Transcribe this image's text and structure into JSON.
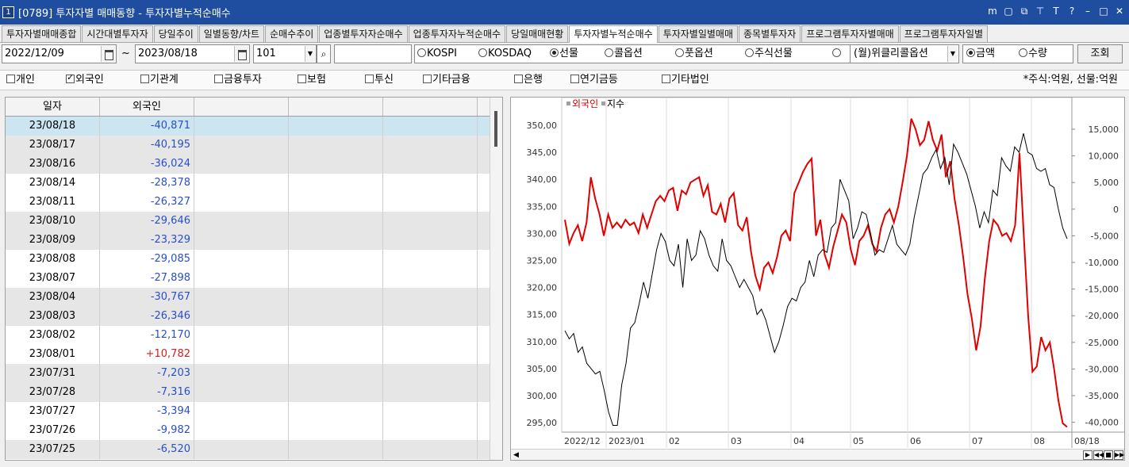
{
  "window": {
    "badge": "1",
    "title": "[0789] 투자자별 매매동향 - 투자자별누적순매수",
    "icons": [
      "menu-icon",
      "save-icon",
      "link-icon",
      "pin-icon",
      "font-icon",
      "help-icon",
      "minimize-icon",
      "maximize-icon",
      "close-icon"
    ]
  },
  "tabs": [
    {
      "label": "투자자별매매종합",
      "active": false
    },
    {
      "label": "시간대별투자자",
      "active": false
    },
    {
      "label": "당일추이",
      "active": false
    },
    {
      "label": "일별동향/차트",
      "active": false
    },
    {
      "label": "순매수추이",
      "active": false
    },
    {
      "label": "업종별투자자순매수",
      "active": false
    },
    {
      "label": "업종투자자누적순매수",
      "active": false
    },
    {
      "label": "당일매매현황",
      "active": false
    },
    {
      "label": "투자자별누적순매수",
      "active": true
    },
    {
      "label": "투자자별일별매매",
      "active": false
    },
    {
      "label": "종목별투자자",
      "active": false
    },
    {
      "label": "프로그램투자자별매매",
      "active": false
    },
    {
      "label": "프로그램투자자일별",
      "active": false
    }
  ],
  "controls": {
    "start_date": "2022/12/09",
    "tilde": "~",
    "end_date": "2023/08/18",
    "code": "101",
    "code_input": "",
    "market_radios": [
      {
        "label": "KOSPI",
        "checked": false
      },
      {
        "label": "KOSDAQ",
        "checked": false
      },
      {
        "label": "선물",
        "checked": true
      },
      {
        "label": "콜옵션",
        "checked": false
      },
      {
        "label": "풋옵션",
        "checked": false
      },
      {
        "label": "주식선물",
        "checked": false
      },
      {
        "label": "",
        "checked": false
      }
    ],
    "weekly_select": "(월)위클리콜옵션",
    "mode_radios": [
      {
        "label": "금액",
        "checked": true
      },
      {
        "label": "수량",
        "checked": false
      }
    ],
    "search_button": "조회"
  },
  "investors": [
    {
      "label": "개인",
      "checked": false
    },
    {
      "label": "외국인",
      "checked": true
    },
    {
      "label": "기관계",
      "checked": false
    },
    {
      "label": "금융투자",
      "checked": false
    },
    {
      "label": "보험",
      "checked": false
    },
    {
      "label": "투신",
      "checked": false
    },
    {
      "label": "기타금융",
      "checked": false
    },
    {
      "label": "은행",
      "checked": false
    },
    {
      "label": "연기금등",
      "checked": false
    },
    {
      "label": "기타법인",
      "checked": false
    }
  ],
  "unit_note": "*주식:억원, 선물:억원",
  "grid": {
    "headers": [
      "일자",
      "외국인",
      "",
      "",
      "",
      ""
    ],
    "rows": [
      {
        "date": "23/08/18",
        "value": "-40,871"
      },
      {
        "date": "23/08/17",
        "value": "-40,195"
      },
      {
        "date": "23/08/16",
        "value": "-36,024"
      },
      {
        "date": "23/08/14",
        "value": "-28,378"
      },
      {
        "date": "23/08/11",
        "value": "-26,327"
      },
      {
        "date": "23/08/10",
        "value": "-29,646"
      },
      {
        "date": "23/08/09",
        "value": "-23,329"
      },
      {
        "date": "23/08/08",
        "value": "-29,085"
      },
      {
        "date": "23/08/07",
        "value": "-27,898"
      },
      {
        "date": "23/08/04",
        "value": "-30,767"
      },
      {
        "date": "23/08/03",
        "value": "-26,346"
      },
      {
        "date": "23/08/02",
        "value": "-12,170"
      },
      {
        "date": "23/08/01",
        "value": "+10,782"
      },
      {
        "date": "23/07/31",
        "value": "-7,203"
      },
      {
        "date": "23/07/28",
        "value": "-7,316"
      },
      {
        "date": "23/07/27",
        "value": "-3,394"
      },
      {
        "date": "23/07/26",
        "value": "-9,982"
      },
      {
        "date": "23/07/25",
        "value": "-6,520"
      }
    ]
  },
  "chart_data": {
    "type": "line",
    "legend": [
      "외국인",
      "지수"
    ],
    "x_labels": [
      "2022/12",
      "2023/01",
      "02",
      "03",
      "04",
      "05",
      "06",
      "07",
      "08",
      "08/18"
    ],
    "left_axis": {
      "ticks": [
        "350,00",
        "345,00",
        "340,00",
        "335,00",
        "330,00",
        "325,00",
        "320,00",
        "315,00",
        "310,00",
        "305,00",
        "300,00",
        "295,00"
      ],
      "ylim": [
        295,
        350
      ]
    },
    "right_axis": {
      "ticks": [
        "15,000",
        "10,000",
        "5,000",
        "0",
        "-5,000",
        "-10,000",
        "-15,000",
        "-20,000",
        "-25,000",
        "-30,000",
        "-35,000",
        "-40,000"
      ],
      "ylim": [
        -40000,
        15000
      ]
    },
    "series": [
      {
        "name": "외국인",
        "axis": "right",
        "color": "#e00000",
        "values": [
          -2000,
          -6500,
          -4500,
          -3000,
          -6000,
          -2500,
          6000,
          2000,
          -1000,
          -5000,
          -1000,
          -3500,
          -2500,
          -3500,
          -2000,
          -3000,
          -2500,
          -4500,
          -1000,
          -3500,
          -1000,
          1500,
          2500,
          1500,
          3500,
          4000,
          -300,
          3500,
          2800,
          5000,
          5500,
          6000,
          2500,
          4500,
          -500,
          -1000,
          1000,
          -2500,
          2000,
          3000,
          -3000,
          -4000,
          -1500,
          -8000,
          -12500,
          -15000,
          -11000,
          -10000,
          -12000,
          -9000,
          -5000,
          -4000,
          -6000,
          3000,
          5000,
          7000,
          8500,
          9500,
          -5000,
          -2000,
          -8500,
          -11000,
          -7000,
          -4000,
          -1000,
          -2500,
          -7500,
          -10500,
          -6000,
          -5000,
          -3000,
          -6500,
          -8000,
          -3500,
          -1000,
          0,
          -2500,
          500,
          5000,
          10000,
          17000,
          15000,
          12000,
          13000,
          16500,
          13000,
          11000,
          14000,
          6000,
          9000,
          2000,
          -3000,
          -9000,
          -16000,
          -20500,
          -26500,
          -22000,
          -13000,
          -6000,
          -2000,
          -3000,
          -5000,
          -4500,
          -6000,
          -3000,
          10500,
          -5000,
          -20000,
          -30500,
          -29500,
          -24000,
          -26500,
          -25000,
          -30000,
          -36000,
          -40195,
          -40871
        ]
      },
      {
        "name": "지수",
        "axis": "left",
        "color": "#000000",
        "values": [
          312,
          310.5,
          311.5,
          308,
          309,
          306,
          305,
          304,
          304.5,
          301,
          297,
          294.5,
          294.5,
          302,
          306,
          312.5,
          313.5,
          317,
          321,
          318,
          322.5,
          327,
          330,
          328.5,
          325,
          324,
          328,
          320,
          329,
          325,
          326,
          330.5,
          329,
          326,
          324,
          323,
          329,
          325,
          324,
          322,
          320,
          321.5,
          320,
          318.5,
          315,
          316,
          314,
          311,
          308,
          310,
          313,
          316.5,
          318,
          317.5,
          320,
          321,
          325,
          322,
          326,
          327,
          326.5,
          331,
          332,
          340,
          338,
          336,
          329,
          331,
          334,
          333.5,
          330,
          326,
          327,
          326.5,
          329,
          331.5,
          328,
          327,
          326,
          328,
          333,
          337,
          341,
          342,
          344,
          345.5,
          342,
          344,
          339,
          346.5,
          345,
          343,
          341,
          338,
          335,
          331,
          334,
          332,
          338,
          337,
          344,
          342.5,
          341.5,
          346,
          345,
          348.5,
          345,
          344.5,
          342,
          341.5,
          342,
          339,
          338.5,
          334.5,
          331,
          329
        ]
      }
    ]
  }
}
